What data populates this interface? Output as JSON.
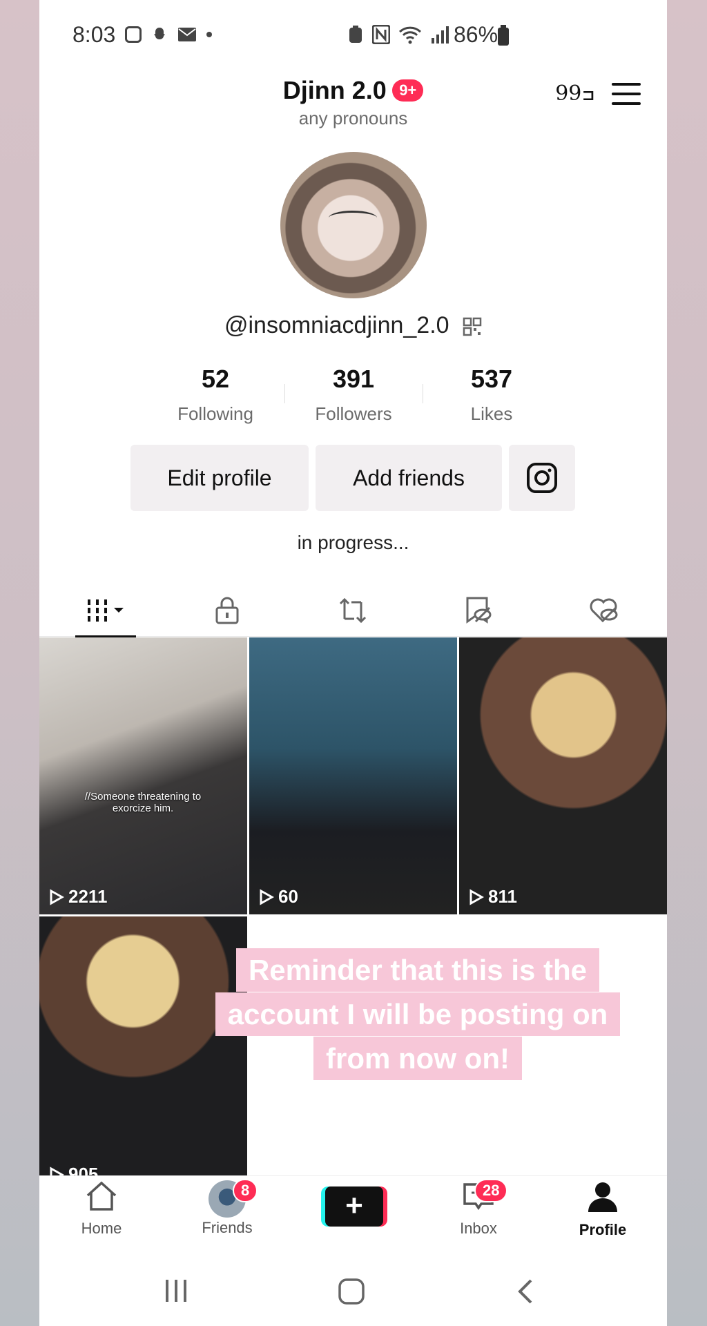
{
  "status_bar": {
    "time": "8:03",
    "battery_text": "86%"
  },
  "header": {
    "display_name": "Djinn 2.0",
    "notification_badge": "9+",
    "pronouns": "any pronouns",
    "streak_icon_text": "ߏ99"
  },
  "profile": {
    "username": "@insomniacdjinn_2.0",
    "bio": "in progress...",
    "stats": [
      {
        "value": "52",
        "label": "Following"
      },
      {
        "value": "391",
        "label": "Followers"
      },
      {
        "value": "537",
        "label": "Likes"
      }
    ]
  },
  "buttons": {
    "edit_profile": "Edit profile",
    "add_friends": "Add friends"
  },
  "videos": [
    {
      "views": "2211",
      "caption": "//Someone threatening to exorcize him."
    },
    {
      "views": "60"
    },
    {
      "views": "811"
    },
    {
      "views": "905"
    }
  ],
  "reminder_text": "Reminder that this is the account I will be posting on from now on!",
  "bottom_nav": {
    "home": "Home",
    "friends": "Friends",
    "friends_badge": "8",
    "inbox": "Inbox",
    "inbox_badge": "28",
    "profile": "Profile"
  },
  "colors": {
    "accent": "#fe2c55",
    "cyan": "#25f4ee",
    "reminder_bg": "#f7c7d8"
  }
}
